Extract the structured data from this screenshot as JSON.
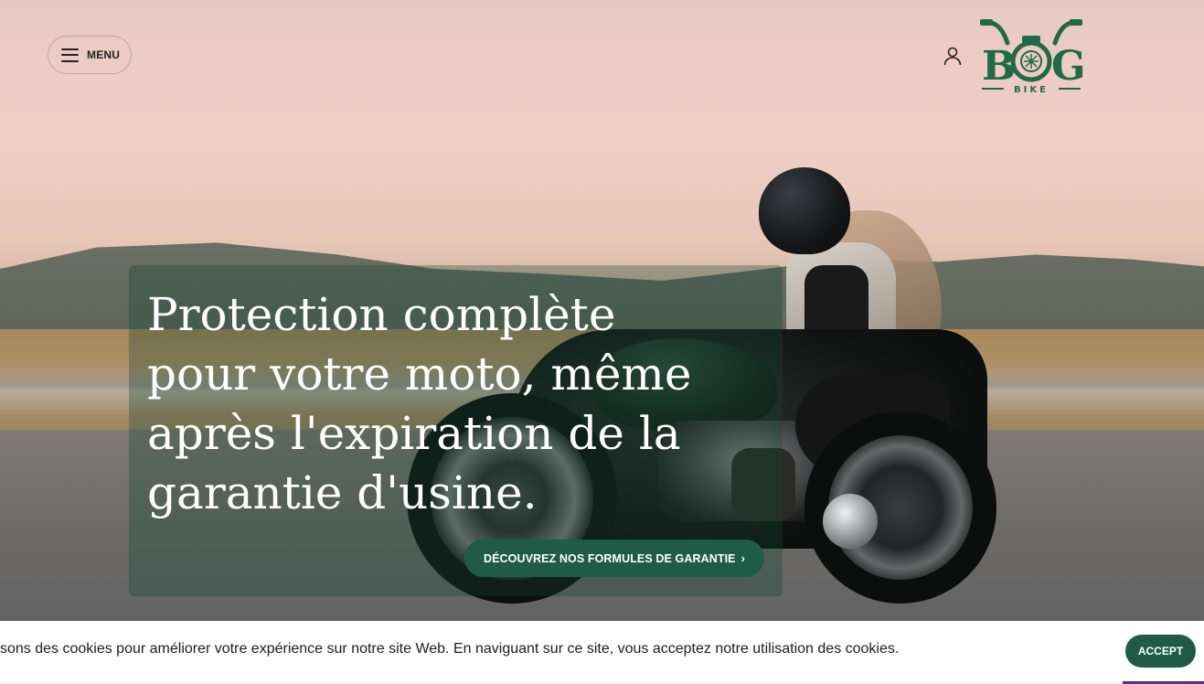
{
  "header": {
    "menu_label": "MENU",
    "logo_text": "BOG",
    "logo_sub": "BIKE"
  },
  "hero": {
    "title": "Protection complète pour votre moto, même après l'expiration de la garantie d'usine.",
    "cta_label": "DÉCOUVREZ NOS FORMULES DE GARANTIE",
    "cta_icon": "chevron-right-icon"
  },
  "cookie": {
    "text": "sons des cookies pour améliorer votre expérience sur notre site Web. En naviguant sur ce site, vous acceptez notre utilisation des cookies.",
    "accept_label": "ACCEPT"
  },
  "colors": {
    "brand_green": "#1f5b47",
    "logo_green": "#1f6a48"
  }
}
